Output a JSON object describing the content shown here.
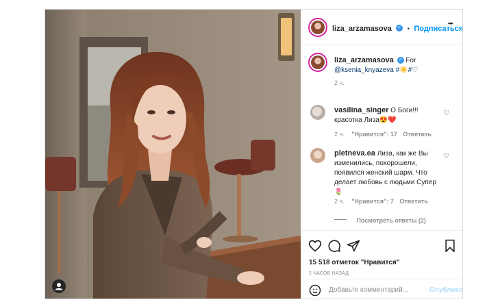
{
  "post": {
    "author": {
      "username": "liza_arzamasova",
      "follow_label": "Подписаться",
      "dot": "•",
      "more_label": "•••"
    },
    "caption": {
      "username": "liza_arzamasova",
      "text": "For",
      "mention": "@ksenia_knyazeva",
      "tail": "#☀️#♡",
      "time": "2 ч."
    },
    "comments": [
      {
        "username": "vasilina_singer",
        "text": "О Боги!!! красотка Лиза😍❤️",
        "time": "2 ч.",
        "likes": "\"Нравится\": 17",
        "reply": "Ответить"
      },
      {
        "username": "pletneva.ea",
        "text": "Лиза, как же Вы изменились, похорошели, появился женский шарм. Что делает любовь с людьми Супер 🌷",
        "time": "2 ч.",
        "likes": "\"Нравится\": 7",
        "reply": "Ответить",
        "view_replies": "Посмотреть ответы (2)"
      }
    ],
    "likes_count": "15 518 отметок \"Нравится\"",
    "posted_ago": "2 ЧАСОВ НАЗАД",
    "add_comment_placeholder": "Добавьте комментарий...",
    "publish_label": "Опубликовать"
  }
}
